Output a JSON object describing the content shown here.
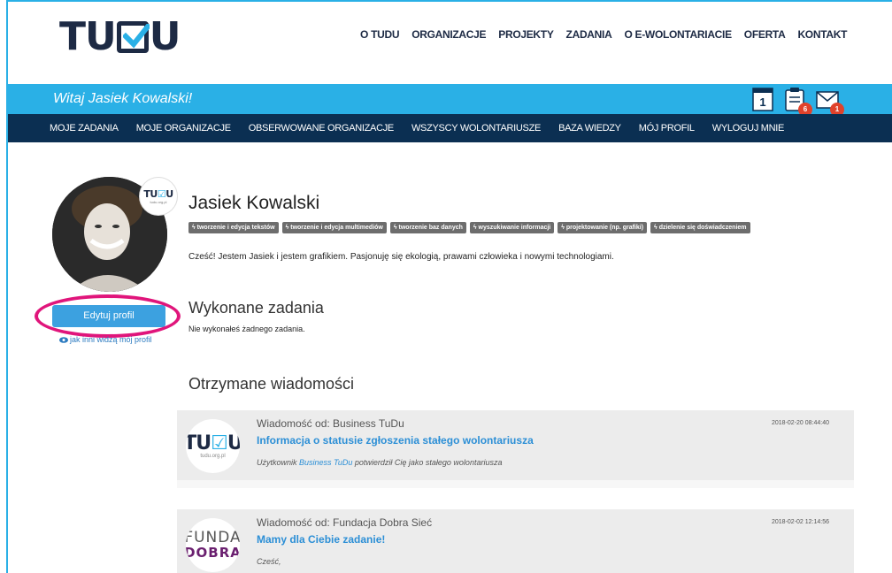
{
  "brand": {
    "logo_left": "TU",
    "logo_right": "U",
    "tudu_url": "tudu.org.pl"
  },
  "top_nav": [
    "O TUDU",
    "ORGANIZACJE",
    "PROJEKTY",
    "ZADANIA",
    "O E-WOLONTARIACIE",
    "OFERTA",
    "KONTAKT"
  ],
  "welcome": "Witaj Jasiek Kowalski!",
  "bar_icons": [
    {
      "icon": "calendar-icon",
      "label": "1",
      "badge": ""
    },
    {
      "icon": "clipboard-icon",
      "label": "",
      "badge": "6"
    },
    {
      "icon": "envelope-icon",
      "label": "",
      "badge": "1"
    }
  ],
  "main_nav": [
    "MOJE ZADANIA",
    "MOJE ORGANIZACJE",
    "OBSERWOWANE ORGANIZACJE",
    "WSZYSCY WOLONTARIUSZE",
    "BAZA WIEDZY",
    "MÓJ PROFIL",
    "WYLOGUJ MNIE"
  ],
  "profile": {
    "name": "Jasiek Kowalski",
    "tags": [
      "tworzenie i edycja tekstów",
      "tworzenie i edycja multimediów",
      "tworzenie baz danych",
      "wyszukiwanie informacji",
      "projektowanie (np. grafiki)",
      "dzielenie się doświadczeniem"
    ],
    "bio": "Cześć! Jestem Jasiek i jestem grafikiem. Pasjonuję się ekologią, prawami człowieka i nowymi technologiami.",
    "edit_label": "Edytuj profil",
    "view_label": "jak inni widzą mój profil"
  },
  "completed": {
    "title": "Wykonane zadania",
    "empty": "Nie wykonałeś żadnego zadania."
  },
  "messages_section": {
    "title": "Otrzymane wiadomości"
  },
  "messages": [
    {
      "from": "Wiadomość od: Business TuDu",
      "subject": "Informacja o statusie zgłoszenia stałego wolontariusza",
      "body_prefix": "Użytkownik ",
      "body_link": "Business TuDu",
      "body_suffix": " potwierdził Cię jako stałego wolontariusza",
      "date": "2018-02-20 08:44:40"
    },
    {
      "from": "Wiadomość od: Fundacja Dobra Sieć",
      "subject": "Mamy dla Ciebie zadanie!",
      "body": "Cześć,",
      "date": "2018-02-02 12:14:56",
      "logo_top": "FUNDA",
      "logo_bottom": "DOBRA"
    }
  ],
  "colors": {
    "accent": "#2ab0e6",
    "nav_dark": "#0b2f52",
    "ring": "#e0157b",
    "link": "#2c8fd6",
    "badge": "#e0422b"
  }
}
